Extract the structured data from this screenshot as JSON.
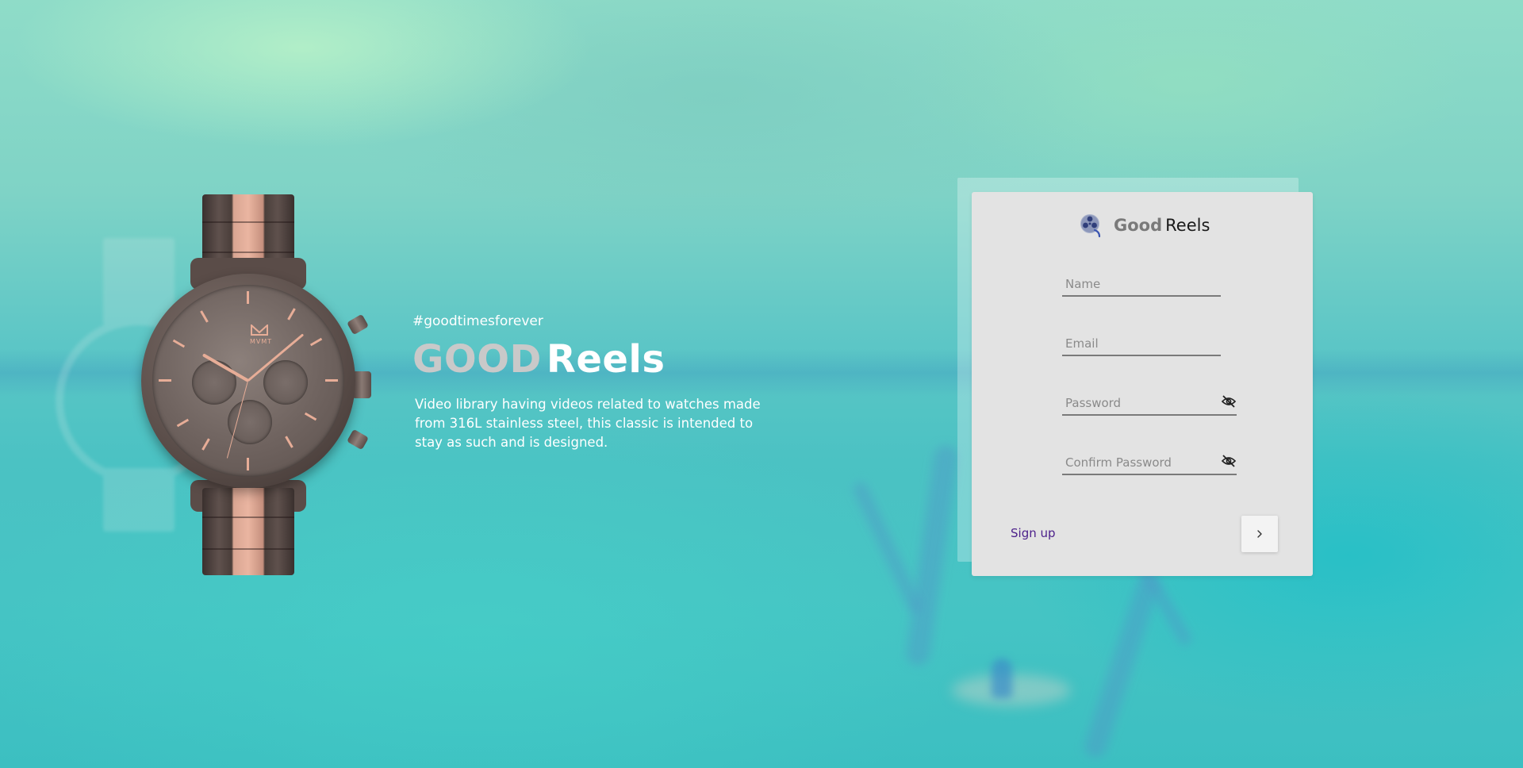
{
  "hero": {
    "hashtag": "#goodtimesforever",
    "title_good": "GOOD",
    "title_reels": "Reels",
    "description": "Video library having videos related to watches made from 316L stainless steel, this classic is intended to stay as such and is designed."
  },
  "watch": {
    "brand_mark": "MVMT"
  },
  "card": {
    "brand_good": "Good",
    "brand_reels": "Reels",
    "name_placeholder": "Name",
    "email_placeholder": "Email",
    "password_placeholder": "Password",
    "confirm_password_placeholder": "Confirm Password",
    "signup_label": "Sign up",
    "icons": {
      "brand": "film-reel-icon",
      "password_toggle": "eye-off-icon",
      "confirm_toggle": "eye-off-icon",
      "next": "chevron-right-icon"
    }
  },
  "colors": {
    "card_bg": "#e3e3e3",
    "signup_link": "#4b1f8a",
    "title_good": "#c9c9c9",
    "brand_good": "#7a7a7a",
    "brand_icon": "#5c6fa8",
    "watch_accent": "#e7ad97"
  }
}
